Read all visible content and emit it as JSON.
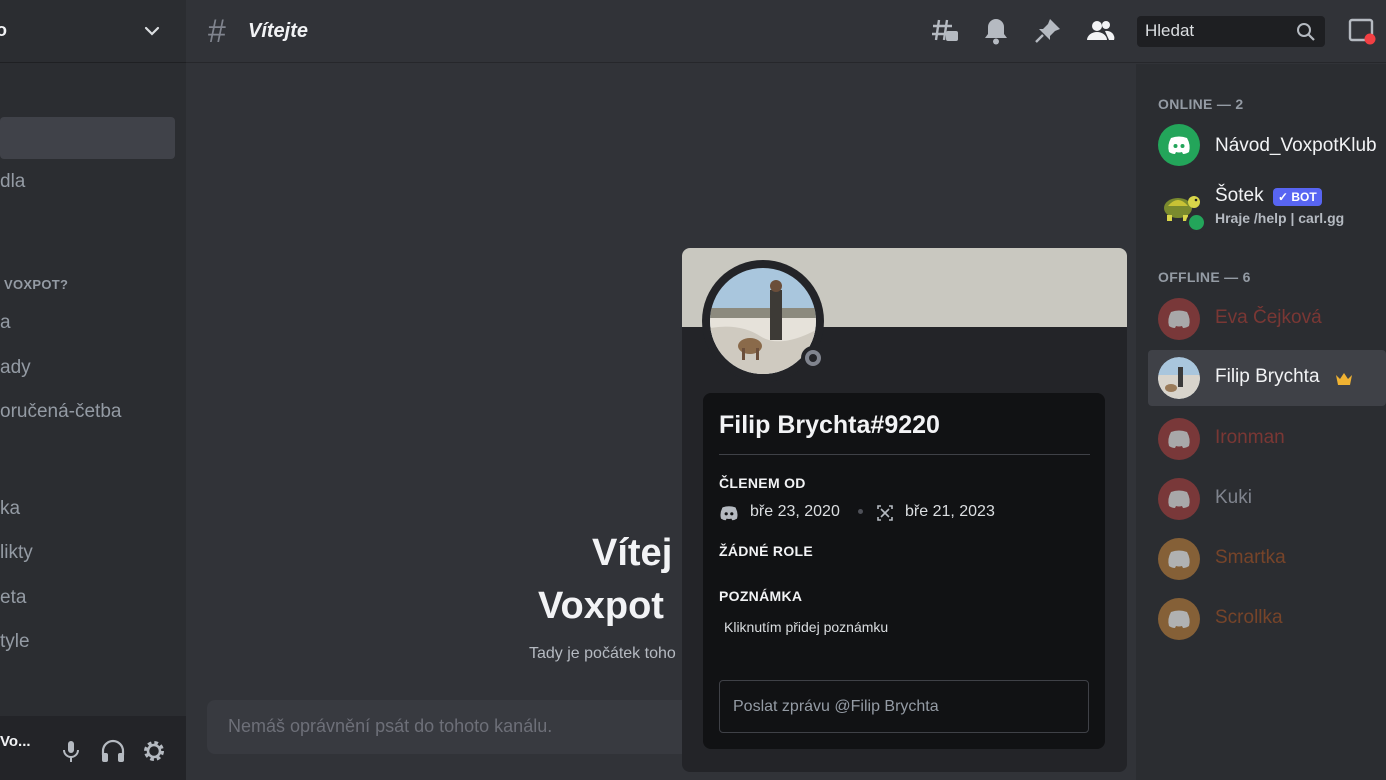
{
  "server": {
    "name": "o"
  },
  "sidebar": {
    "channels": [
      {
        "label": "dla"
      },
      {
        "label": "a"
      },
      {
        "label": "ady"
      },
      {
        "label": "oručená-četba"
      },
      {
        "label": "ka"
      },
      {
        "label": "likty"
      },
      {
        "label": "eta"
      },
      {
        "label": "tyle"
      }
    ],
    "category": "VOXPOT?"
  },
  "userbar": {
    "username": "Vo..."
  },
  "header": {
    "channel_title": "Vítejte",
    "search_placeholder": "Hledat"
  },
  "main": {
    "welcome_line1": "Vítej",
    "welcome_line2": "Voxpot",
    "welcome_sub": "Tady je počátek toho",
    "message_placeholder": "Nemáš oprávnění psát do tohoto kanálu."
  },
  "members": {
    "online_header": "ONLINE — 2",
    "offline_header": "OFFLINE — 6",
    "online": [
      {
        "name": "Návod_VoxpotKlub",
        "color": "#f2f3f5",
        "avatar_color": "#23a55a"
      },
      {
        "name": "Šotek",
        "badge": "✓ BOT",
        "activity": "Hraje /help | carl.gg",
        "color": "#f2f3f5"
      }
    ],
    "offline": [
      {
        "name": "Eva Čejková",
        "color": "#b5453d",
        "avatar_color": "#9b3d3d"
      },
      {
        "name": "Filip Brychta",
        "color": "#f2f3f5",
        "selected": true
      },
      {
        "name": "Ironman",
        "color": "#b5453d",
        "avatar_color": "#9b3d3d"
      },
      {
        "name": "Kuki",
        "color": "#80848e",
        "avatar_color": "#9b3d3d"
      },
      {
        "name": "Smartka",
        "color": "#a0522d",
        "avatar_color": "#a4723a"
      },
      {
        "name": "Scrollka",
        "color": "#a0522d",
        "avatar_color": "#a4723a"
      }
    ],
    "accent_bot": "#5865f2"
  },
  "popout": {
    "username": "Filip Brychta#9220",
    "member_since_header": "ČLENEM OD",
    "discord_date": "bře 23, 2020",
    "server_date": "bře 21, 2023",
    "roles_header": "ŽÁDNÉ ROLE",
    "note_header": "POZNÁMKA",
    "note_placeholder": "Kliknutím přidej poznámku",
    "message_placeholder": "Poslat zprávu @Filip Brychta",
    "banner_color": "#c9c8c0"
  }
}
